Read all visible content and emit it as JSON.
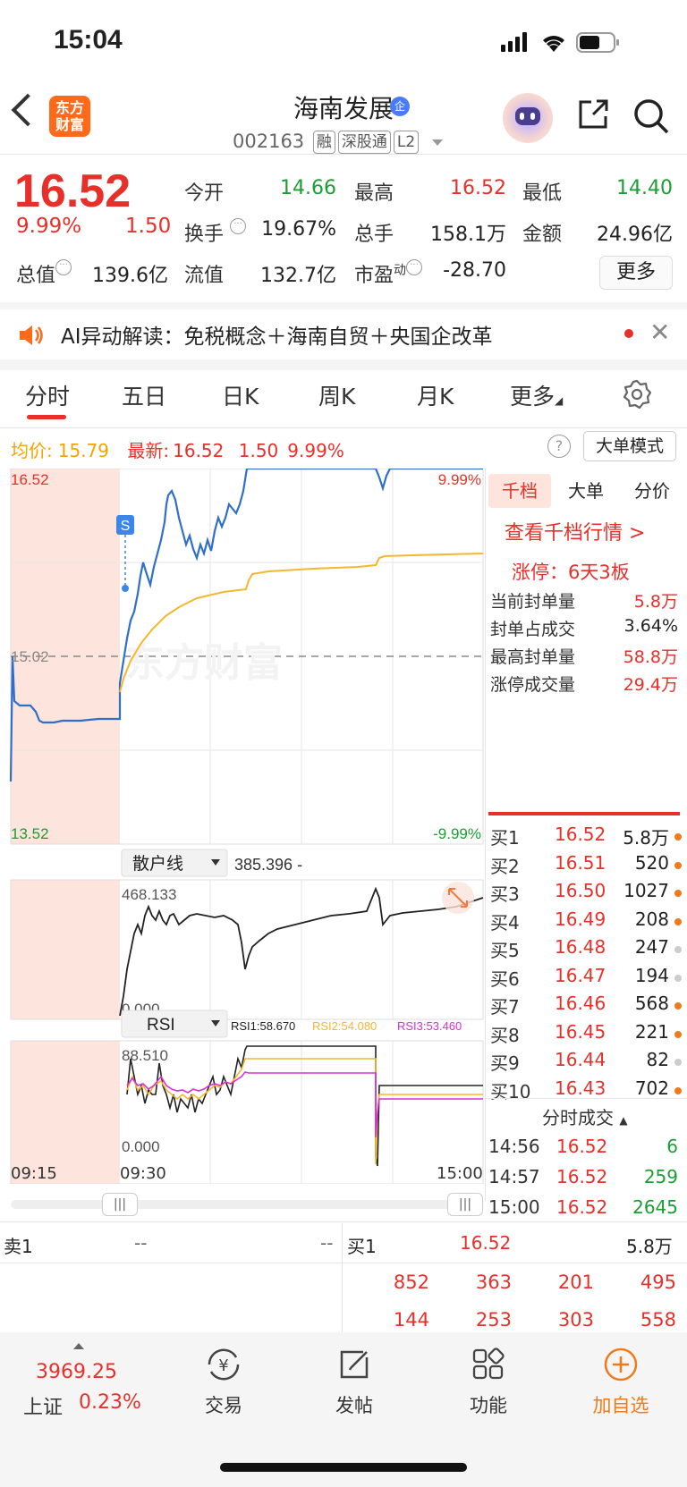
{
  "status": {
    "time": "15:04"
  },
  "header": {
    "logo_text": "东方\n财富",
    "name": "海南发展",
    "verified_badge": "企",
    "code": "002163",
    "tags": [
      "融",
      "深股通",
      "L2"
    ]
  },
  "quote": {
    "price": "16.52",
    "change_pct": "9.99%",
    "change_amt": "1.50",
    "rows": [
      [
        {
          "label": "今开",
          "value": "14.66",
          "color": "green"
        },
        {
          "label": "最高",
          "value": "16.52",
          "color": "red"
        },
        {
          "label": "最低",
          "value": "14.40",
          "color": "green"
        }
      ],
      [
        {
          "label": "换手",
          "value": "19.67%",
          "color": "dark",
          "info": true
        },
        {
          "label": "总手",
          "value": "158.1万",
          "color": "dark"
        },
        {
          "label": "金额",
          "value": "24.96亿",
          "color": "dark"
        }
      ]
    ],
    "total_value_label": "总值",
    "total_value": "139.6亿",
    "float_value_label": "流值",
    "float_value": "132.7亿",
    "pe_label": "市盈",
    "pe_sup": "动",
    "pe_value": "-28.70",
    "more_label": "更多"
  },
  "ai_bar": {
    "text": "AI异动解读：免税概念＋海南自贸＋央国企改革"
  },
  "tabs": [
    "分时",
    "五日",
    "日K",
    "周K",
    "月K",
    "更多"
  ],
  "avg_row": {
    "avg_label": "均价:",
    "avg_value": "15.79",
    "latest_label": "最新:",
    "latest_value": "16.52",
    "latest_change": "1.50",
    "latest_pct": "9.99%",
    "mode_label": "大单模式"
  },
  "chart_data": [
    {
      "type": "line",
      "title": "分时",
      "y_max_label": "16.52",
      "y_mid_label": "15.02",
      "y_min_label": "13.52",
      "pct_max_label": "9.99%",
      "pct_min_label": "-9.99%",
      "watermark": "东方财富",
      "signal": "S",
      "x_labels": [
        "09:15",
        "09:30",
        "15:00"
      ],
      "ylim": [
        13.52,
        16.52
      ],
      "series": [
        {
          "name": "price",
          "color": "#2f6fc9"
        },
        {
          "name": "avg",
          "color": "#f5b72f"
        }
      ]
    },
    {
      "type": "line",
      "title": "散户线",
      "value_label": "385.396 -",
      "y_max_label": "468.133",
      "y_min_label": "0.000"
    },
    {
      "type": "line",
      "title": "RSI",
      "legend": [
        {
          "name": "RSI1:58.670",
          "color": "#222"
        },
        {
          "name": "RSI2:54.080",
          "color": "#f5b72f"
        },
        {
          "name": "RSI3:53.460",
          "color": "#d630d6"
        }
      ],
      "y_max_label": "88.510",
      "y_min_label": "0.000"
    }
  ],
  "right_panel": {
    "tabs": [
      "千档",
      "大单",
      "分价"
    ],
    "link": "查看千档行情 >",
    "limit_title": "涨停：6天3板",
    "stats": [
      {
        "label": "当前封单量",
        "value": "5.8万",
        "color": "red"
      },
      {
        "label": "封单占成交",
        "value": "3.64%",
        "color": "dark"
      },
      {
        "label": "最高封单量",
        "value": "58.8万",
        "color": "red"
      },
      {
        "label": "涨停成交量",
        "value": "29.4万",
        "color": "red"
      }
    ],
    "bids": [
      {
        "label": "买1",
        "price": "16.52",
        "vol": "5.8万",
        "dot": "orange"
      },
      {
        "label": "买2",
        "price": "16.51",
        "vol": "520",
        "dot": "orange"
      },
      {
        "label": "买3",
        "price": "16.50",
        "vol": "1027",
        "dot": "orange"
      },
      {
        "label": "买4",
        "price": "16.49",
        "vol": "208",
        "dot": "orange"
      },
      {
        "label": "买5",
        "price": "16.48",
        "vol": "247",
        "dot": "gray"
      },
      {
        "label": "买6",
        "price": "16.47",
        "vol": "194",
        "dot": "gray"
      },
      {
        "label": "买7",
        "price": "16.46",
        "vol": "568",
        "dot": "orange"
      },
      {
        "label": "买8",
        "price": "16.45",
        "vol": "221",
        "dot": "orange"
      },
      {
        "label": "买9",
        "price": "16.44",
        "vol": "82",
        "dot": "gray"
      },
      {
        "label": "买10",
        "price": "16.43",
        "vol": "702",
        "dot": "orange"
      }
    ],
    "ticks_title": "分时成交",
    "ticks": [
      {
        "time": "14:56",
        "price": "16.52",
        "vol": "6"
      },
      {
        "time": "14:57",
        "price": "16.52",
        "vol": "259"
      },
      {
        "time": "15:00",
        "price": "16.52",
        "vol": "2645"
      }
    ]
  },
  "bottom_quote": {
    "sell_label": "卖1",
    "sell_price": "--",
    "sell_vol": "--",
    "buy_label": "买1",
    "buy_price": "16.52",
    "buy_vol": "5.8万",
    "row1": [
      "852",
      "363",
      "201",
      "495"
    ],
    "row2": [
      "144",
      "253",
      "303",
      "558"
    ]
  },
  "bottom_nav": {
    "index_value": "3969.25",
    "index_name": "上证",
    "index_pct": "0.23%",
    "items": [
      {
        "label": "交易"
      },
      {
        "label": "发帖"
      },
      {
        "label": "功能"
      },
      {
        "label": "加自选"
      }
    ]
  }
}
